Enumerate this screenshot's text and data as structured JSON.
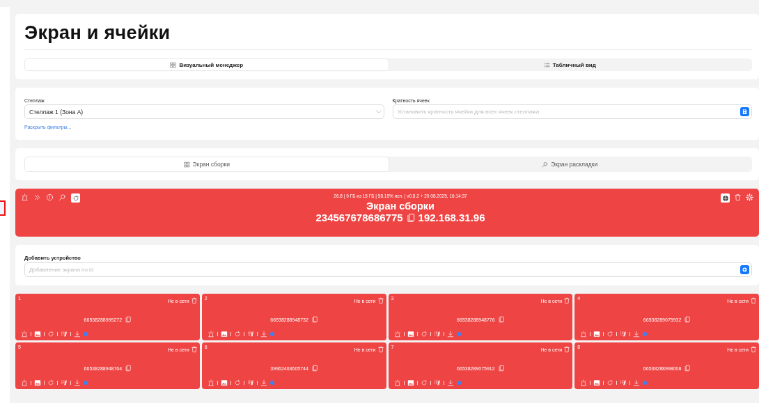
{
  "page_title": "Экран и ячейки",
  "view_tabs": [
    {
      "label": "Визуальный менеджер",
      "selected": true
    },
    {
      "label": "Табличный вид",
      "selected": false
    }
  ],
  "filters": {
    "rack": {
      "label": "Стеллаж",
      "value": "Стеллаж 1 (Зона А)"
    },
    "multiplicity": {
      "label": "Кратность ячеек",
      "placeholder": "Установить кратность ячейки для всех ячеек стеллажа"
    },
    "expand_link": "Раскрыть фильтры..."
  },
  "screen_tabs": [
    {
      "label": "Экран сборки",
      "selected": true
    },
    {
      "label": "Экран раскладки",
      "selected": false
    }
  ],
  "screen": {
    "online": false,
    "stats": "26.8 | 9 ГБ из 15 ГБ | 58.15% исп. | v0.8.2 + 20.08.2025, 16:14:37",
    "title": "Экран сборки",
    "device_id": "234567678686775",
    "ip": "192.168.31.96"
  },
  "add_device": {
    "label": "Добавить устройство",
    "placeholder": "Добавление экрана по id"
  },
  "cells": [
    {
      "number": "1",
      "status": "Не в сети",
      "online": false,
      "device_id": "66538288999272",
      "color": "#3b82f6"
    },
    {
      "number": "2",
      "status": "Не в сети",
      "online": false,
      "device_id": "66538288948732",
      "color": "#3b82f6"
    },
    {
      "number": "3",
      "status": "Не в сети",
      "online": false,
      "device_id": "66538288948776",
      "color": "#3b82f6"
    },
    {
      "number": "4",
      "status": "Не в сети",
      "online": false,
      "device_id": "66538289075932",
      "color": "#3b82f6"
    },
    {
      "number": "5",
      "status": "Не в сети",
      "online": false,
      "device_id": "66538288948764",
      "color": "#3b82f6"
    },
    {
      "number": "6",
      "status": "Не в сети",
      "online": false,
      "device_id": "39962463605744",
      "color": "#3b82f6"
    },
    {
      "number": "7",
      "status": "Не в сети",
      "online": false,
      "device_id": "66538289075912",
      "color": "#3b82f6"
    },
    {
      "number": "8",
      "status": "Не в сети",
      "online": false,
      "device_id": "66538288998008",
      "color": "#3b82f6"
    }
  ]
}
